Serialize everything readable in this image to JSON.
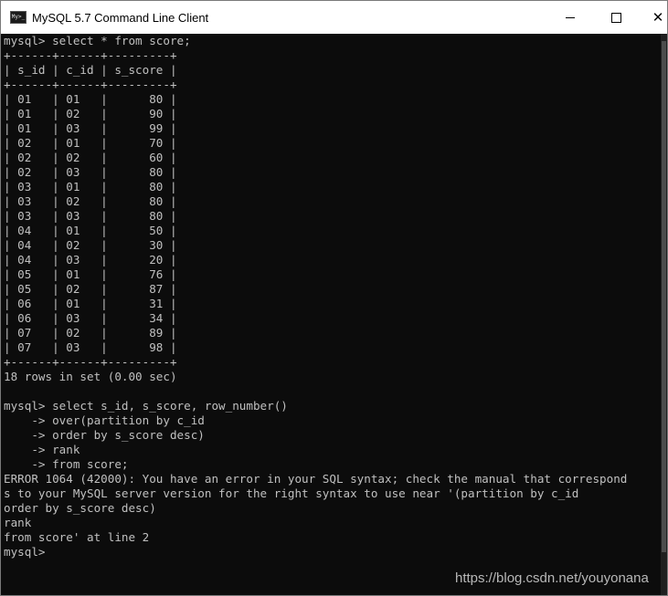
{
  "window": {
    "title": "MySQL 5.7 Command Line Client",
    "icon_label": "My>_"
  },
  "console": {
    "lines": [
      "mysql> select * from score;",
      "+------+------+---------+",
      "| s_id | c_id | s_score |",
      "+------+------+---------+",
      "| 01   | 01   |      80 |",
      "| 01   | 02   |      90 |",
      "| 01   | 03   |      99 |",
      "| 02   | 01   |      70 |",
      "| 02   | 02   |      60 |",
      "| 02   | 03   |      80 |",
      "| 03   | 01   |      80 |",
      "| 03   | 02   |      80 |",
      "| 03   | 03   |      80 |",
      "| 04   | 01   |      50 |",
      "| 04   | 02   |      30 |",
      "| 04   | 03   |      20 |",
      "| 05   | 01   |      76 |",
      "| 05   | 02   |      87 |",
      "| 06   | 01   |      31 |",
      "| 06   | 03   |      34 |",
      "| 07   | 02   |      89 |",
      "| 07   | 03   |      98 |",
      "+------+------+---------+",
      "18 rows in set (0.00 sec)",
      "",
      "mysql> select s_id, s_score, row_number()",
      "    -> over(partition by c_id",
      "    -> order by s_score desc)",
      "    -> rank",
      "    -> from score;",
      "ERROR 1064 (42000): You have an error in your SQL syntax; check the manual that correspond",
      "s to your MySQL server version for the right syntax to use near '(partition by c_id",
      "order by s_score desc)",
      "rank",
      "from score' at line 2",
      "mysql>"
    ]
  },
  "watermark": "https://blog.csdn.net/youyonana"
}
